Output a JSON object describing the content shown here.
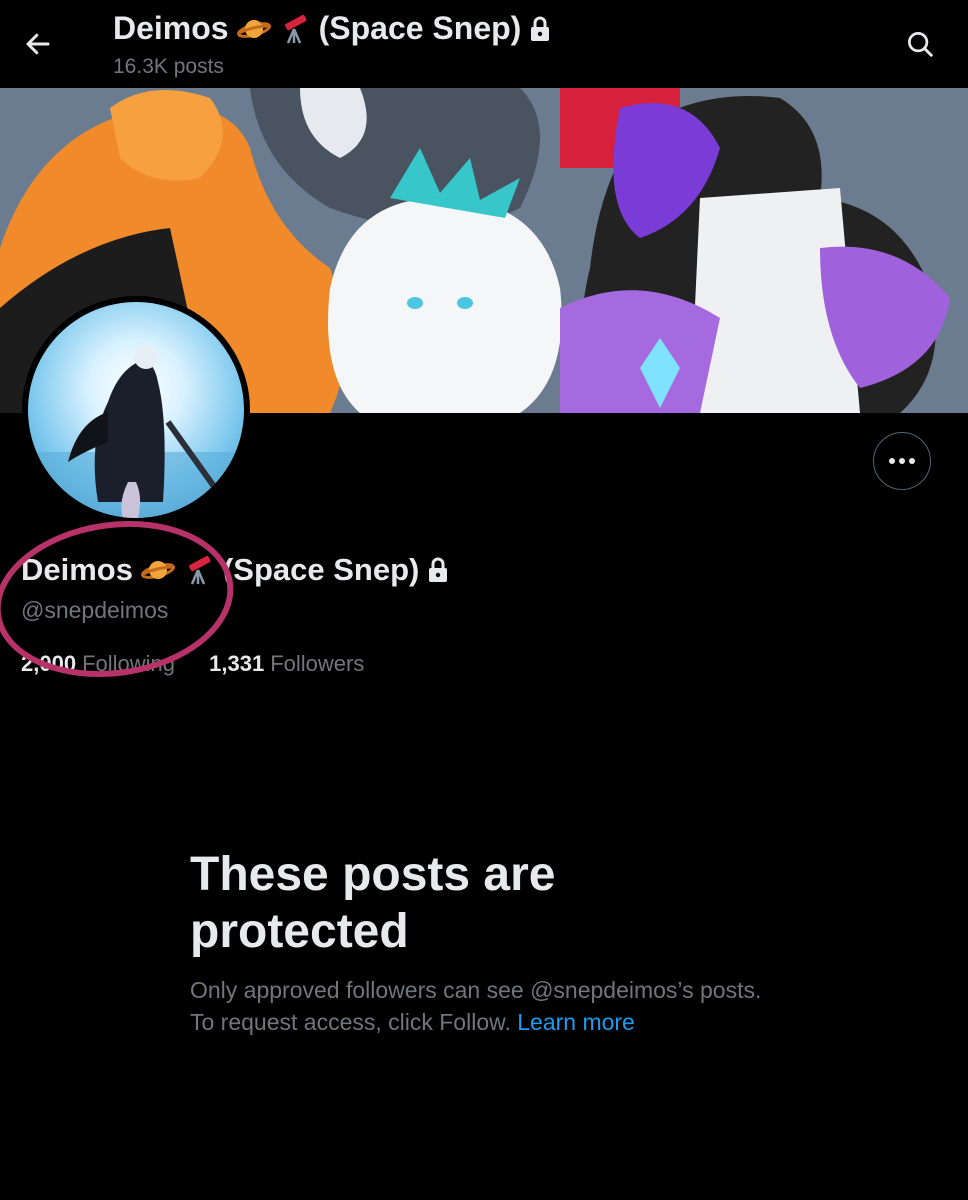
{
  "header": {
    "name": "Deimos",
    "name_suffix": "(Space Snep)",
    "posts_count": "16.3K posts"
  },
  "profile": {
    "display_name": "Deimos",
    "display_name_suffix": "(Space Snep)",
    "handle": "@snepdeimos",
    "following_count": "2,000",
    "following_label": "Following",
    "followers_count": "1,331",
    "followers_label": "Followers"
  },
  "protected_notice": {
    "title": "These posts are protected",
    "body": "Only approved followers can see @snepdeimos’s posts. To request access, click Follow.",
    "link": "Learn more"
  },
  "icons": {
    "back": "arrow-left-icon",
    "search": "search-icon",
    "more": "more-icon",
    "planet": "ringed-planet-icon",
    "telescope": "telescope-icon",
    "lock": "lock-icon"
  },
  "colors": {
    "background": "#000000",
    "primary_text": "#e7e9ea",
    "secondary_text": "#71767b",
    "link": "#1d9bf0",
    "highlight_ring": "#b8326a"
  }
}
